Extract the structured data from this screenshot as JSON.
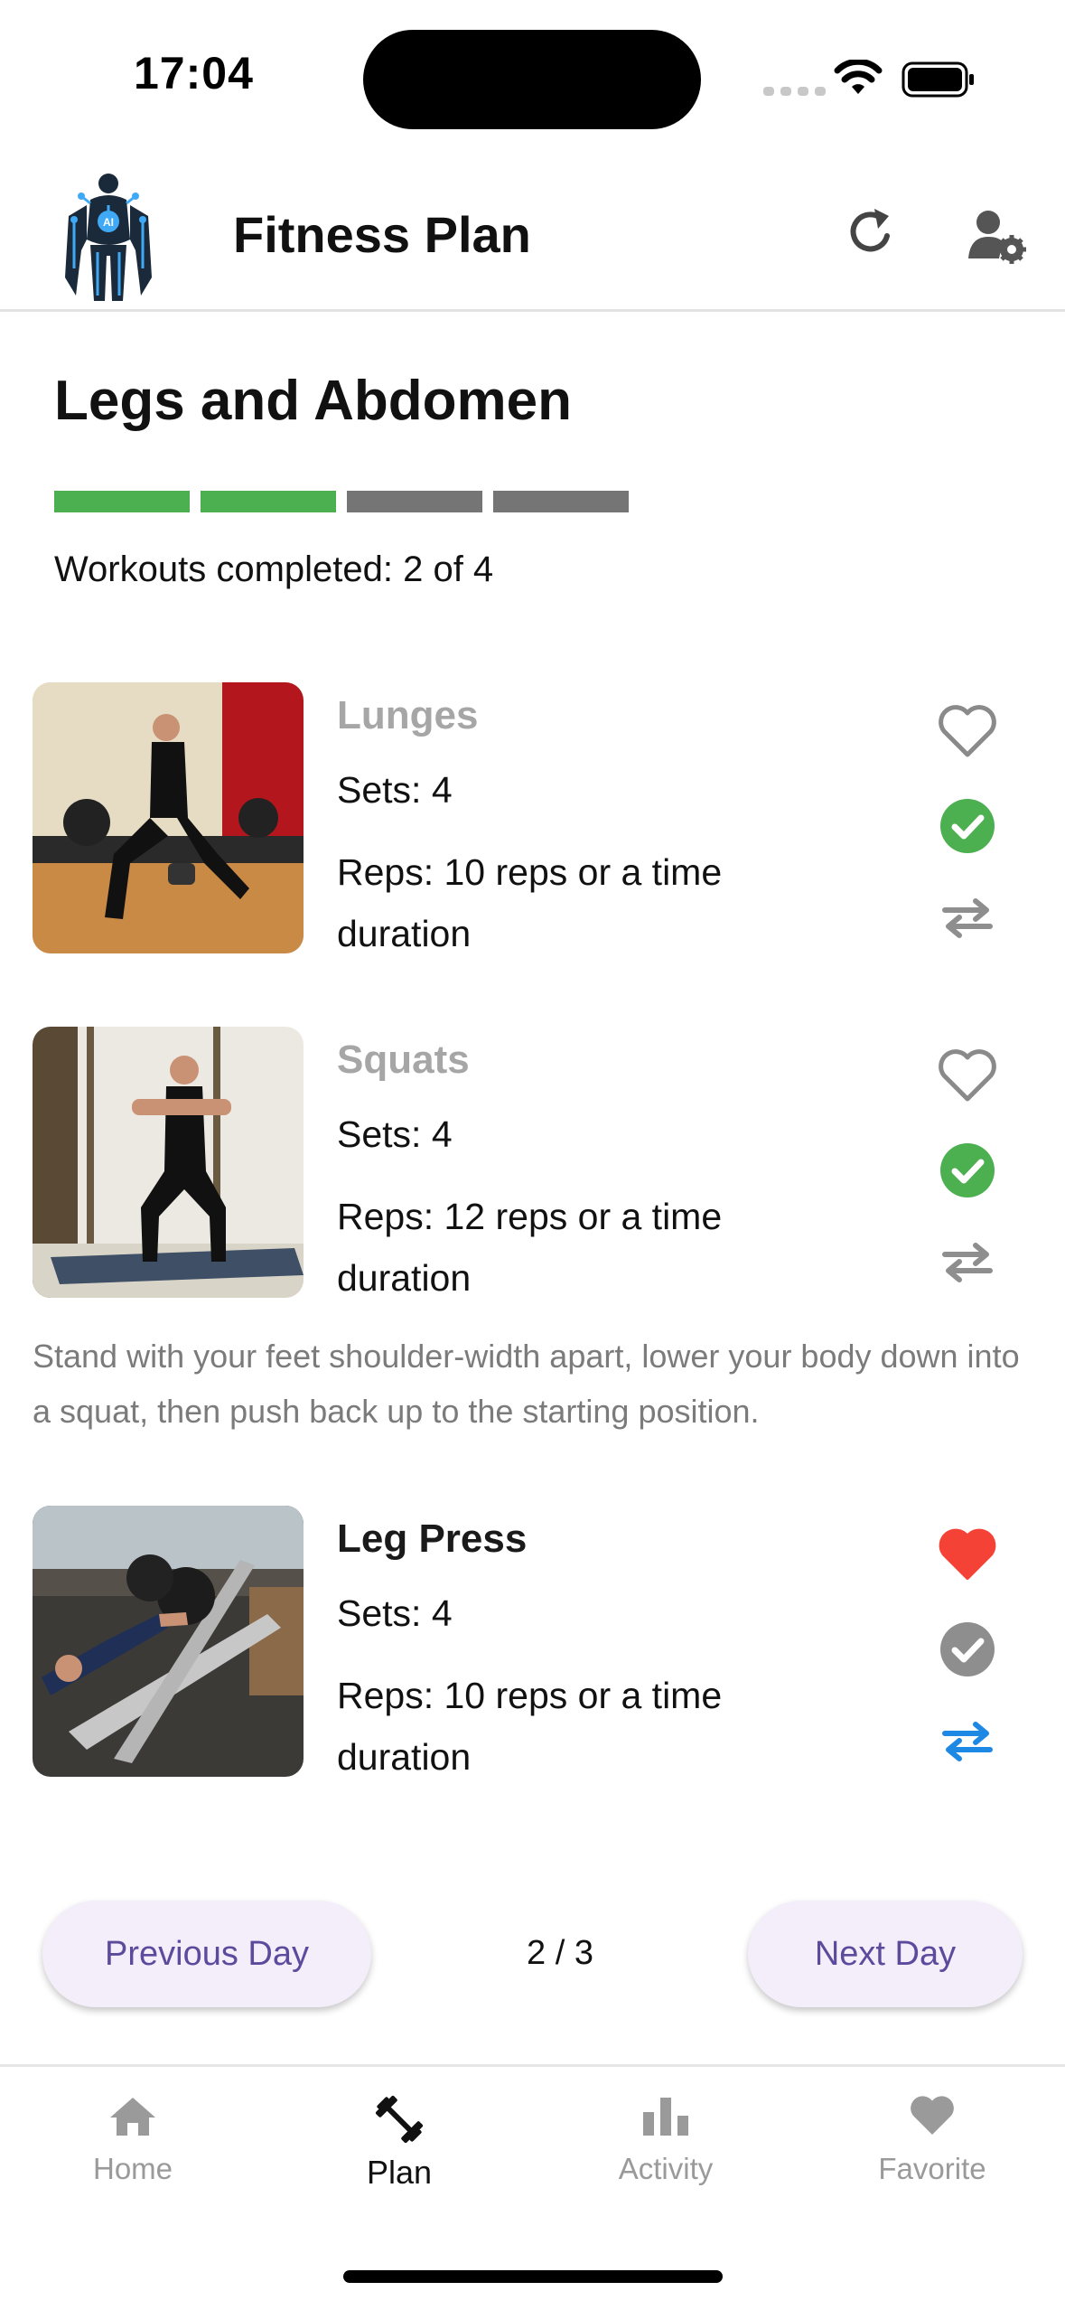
{
  "status_bar": {
    "time": "17:04"
  },
  "header": {
    "title": "Fitness Plan",
    "logo_text": "AI"
  },
  "plan": {
    "day_title": "Legs and Abdomen",
    "progress": {
      "completed": 2,
      "total": 4
    },
    "workouts_completed_text": "Workouts completed: 2 of 4"
  },
  "exercises": [
    {
      "name": "Lunges",
      "sets": "Sets: 4",
      "reps": "Reps: 10 reps or a time duration",
      "favorite": false,
      "done": true,
      "state": "completed"
    },
    {
      "name": "Squats",
      "sets": "Sets: 4",
      "reps": "Reps: 12 reps or a time duration",
      "favorite": false,
      "done": true,
      "state": "completed",
      "description": "Stand with your feet shoulder-width apart, lower your body down into a squat, then push back up to the starting position."
    },
    {
      "name": "Leg Press",
      "sets": "Sets: 4",
      "reps": "Reps: 10 reps or a time duration",
      "favorite": true,
      "done": false,
      "state": "pending"
    }
  ],
  "day_nav": {
    "previous": "Previous Day",
    "next": "Next Day",
    "page": "2 / 3"
  },
  "bottom_nav": {
    "items": [
      {
        "label": "Home",
        "icon": "home-icon",
        "active": false
      },
      {
        "label": "Plan",
        "icon": "dumbbell-icon",
        "active": true
      },
      {
        "label": "Activity",
        "icon": "bar-chart-icon",
        "active": false
      },
      {
        "label": "Favorite",
        "icon": "heart-icon",
        "active": false
      }
    ]
  },
  "colors": {
    "progress_done": "#4caf50",
    "progress_pending": "#757575",
    "check_done": "#4caf50",
    "check_pending": "#8e8e8e",
    "favorite_on": "#f44336",
    "swap_active": "#1e88e5",
    "day_button_bg": "#f3eef9",
    "day_button_text": "#5c4a9c"
  }
}
